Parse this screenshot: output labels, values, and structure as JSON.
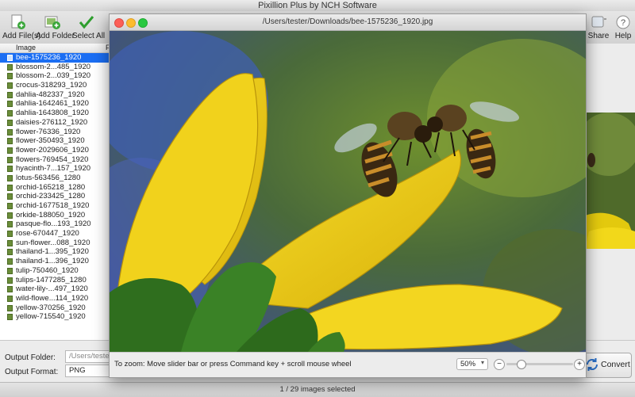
{
  "app": {
    "title": "Pixillion Plus by NCH Software"
  },
  "toolbar": {
    "add_files": "Add File(s)",
    "add_folder": "Add Folder",
    "select_all": "Select All",
    "share": "Share",
    "help": "Help"
  },
  "file_list": {
    "header_image": "Image",
    "header_f": "F",
    "items": [
      "bee-1575236_1920",
      "blossom-2...485_1920",
      "blossom-2...039_1920",
      "crocus-318293_1920",
      "dahlia-482337_1920",
      "dahlia-1642461_1920",
      "dahlia-1643808_1920",
      "daisies-276112_1920",
      "flower-76336_1920",
      "flower-350493_1920",
      "flower-2029606_1920",
      "flowers-769454_1920",
      "hyacinth-7...157_1920",
      "lotus-563456_1280",
      "orchid-165218_1280",
      "orchid-233425_1280",
      "orchid-1677518_1920",
      "orkide-188050_1920",
      "pasque-flo...193_1920",
      "rose-670447_1920",
      "sun-flower...088_1920",
      "thailand-1...395_1920",
      "thailand-1...396_1920",
      "tulip-750460_1920",
      "tulips-1477285_1280",
      "water-lily-...497_1920",
      "wild-flowe...114_1920",
      "yellow-370256_1920",
      "yellow-715540_1920"
    ],
    "selected_index": 0
  },
  "output": {
    "folder_label": "Output Folder:",
    "folder_value": "/Users/tester/",
    "format_label": "Output Format:",
    "format_value": "PNG"
  },
  "convert_label": "Convert",
  "status": "1 / 29 images selected",
  "preview": {
    "title": "/Users/tester/Downloads/bee-1575236_1920.jpg",
    "zoom_hint": "To zoom: Move slider bar or press Command key + scroll mouse wheel",
    "zoom_value": "50%",
    "zoom_level": 0.12,
    "minus": "−",
    "plus": "+"
  },
  "colors": {
    "selection": "#1b6ef3",
    "close": "#fc5f57",
    "minimize": "#fdbc2e",
    "zoom": "#29c840"
  }
}
